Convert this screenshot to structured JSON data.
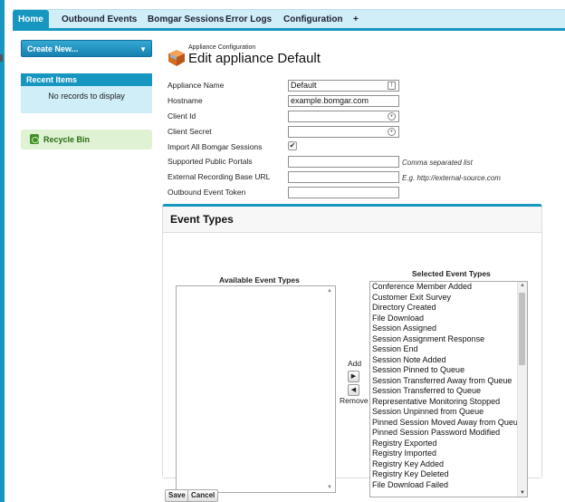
{
  "tabs": [
    {
      "label": "Home",
      "active": true
    },
    {
      "label": "Outbound Events",
      "active": false
    },
    {
      "label": "Bomgar Sessions",
      "active": false
    },
    {
      "label": "Error Logs",
      "active": false
    },
    {
      "label": "Configuration",
      "active": false
    },
    {
      "label": "+",
      "active": false
    }
  ],
  "sidebar": {
    "create_new": "Create New...",
    "recent_items_title": "Recent Items",
    "recent_items_empty": "No records to display",
    "recycle_bin": "Recycle Bin"
  },
  "header": {
    "subtitle": "Appliance Configuration",
    "title": "Edit appliance Default"
  },
  "form": {
    "appliance_name": {
      "label": "Appliance Name",
      "value": "Default"
    },
    "hostname": {
      "label": "Hostname",
      "value": "example.bomgar.com"
    },
    "client_id": {
      "label": "Client Id",
      "value": ""
    },
    "client_secret": {
      "label": "Client Secret",
      "value": ""
    },
    "import_all": {
      "label": "Import All Bomgar Sessions",
      "checked": true,
      "mark": "✔"
    },
    "public_portals": {
      "label": "Supported Public Portals",
      "value": "",
      "hint": "Comma separated list"
    },
    "recording_url": {
      "label": "External Recording Base URL",
      "value": "",
      "hint": "E.g. http://external-source.com"
    },
    "event_token": {
      "label": "Outbound Event Token",
      "value": ""
    }
  },
  "event_types": {
    "title": "Event Types",
    "available_label": "Available Event Types",
    "selected_label": "Selected Event Types",
    "add_label": "Add",
    "remove_label": "Remove",
    "selected": [
      "Conference Member Added",
      "Customer Exit Survey",
      "Directory Created",
      "File Download",
      "Session Assigned",
      "Session Assignment Response",
      "Session End",
      "Session Note Added",
      "Session Pinned to Queue",
      "Session Transferred Away from Queue",
      "Session Transferred to Queue",
      "Representative Monitoring Stopped",
      "Session Unpinned from Queue",
      "Pinned Session Moved Away from Queue",
      "Pinned Session Password Modified",
      "Registry Exported",
      "Registry Imported",
      "Registry Key Added",
      "Registry Key Deleted",
      "File Download Failed"
    ]
  },
  "actions": {
    "save": "Save",
    "cancel": "Cancel"
  },
  "colors": {
    "accent": "#1797c0",
    "tab_bar": "#cfeef8",
    "recycle_bg": "#dff3d4"
  }
}
